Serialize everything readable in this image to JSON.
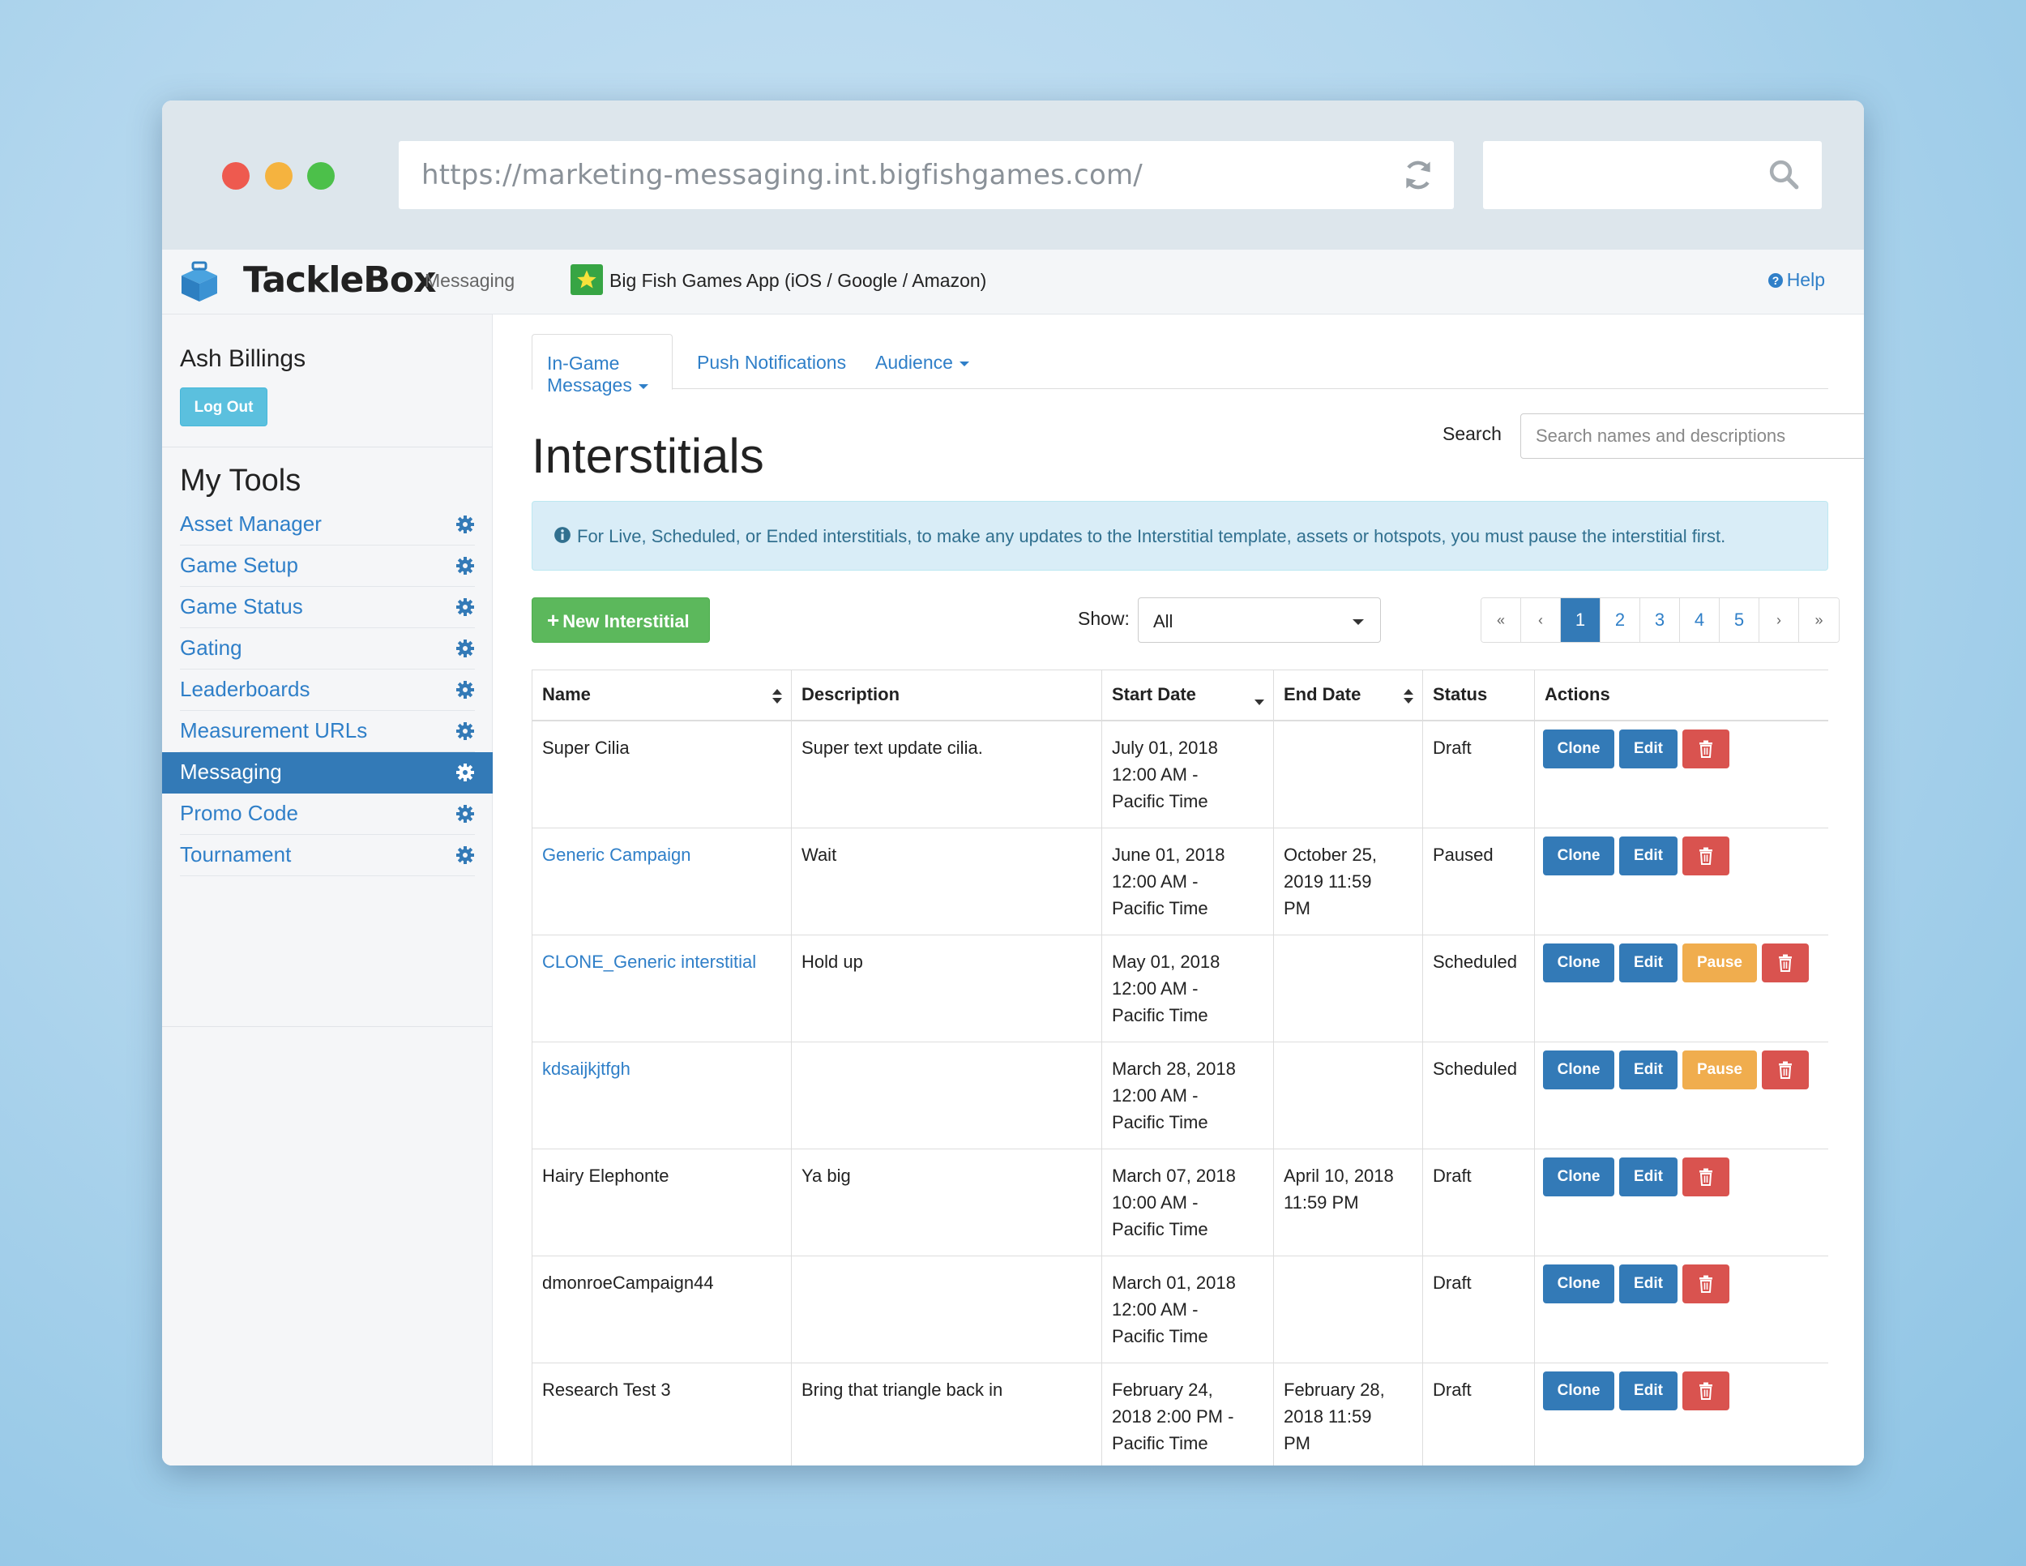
{
  "browser": {
    "url": "https://marketing-messaging.int.bigfishgames.com/",
    "search_value": ""
  },
  "navbar": {
    "logo_text": "TackleBox",
    "section": "Messaging",
    "app_name": "Big Fish Games App (iOS / Google / Amazon)",
    "help": "Help"
  },
  "sidebar": {
    "user_name": "Ash Billings",
    "logout": "Log Out",
    "tools_title": "My Tools",
    "items": [
      {
        "label": "Asset Manager"
      },
      {
        "label": "Game Setup"
      },
      {
        "label": "Game Status"
      },
      {
        "label": "Gating"
      },
      {
        "label": "Leaderboards"
      },
      {
        "label": "Measurement URLs"
      },
      {
        "label": "Messaging",
        "active": true
      },
      {
        "label": "Promo Code"
      },
      {
        "label": "Tournament"
      }
    ]
  },
  "main": {
    "tabs": [
      {
        "label": "In-Game Messages",
        "dropdown": true,
        "active": true
      },
      {
        "label": "Push Notifications"
      },
      {
        "label": "Audience",
        "dropdown": true
      }
    ],
    "title": "Interstitials",
    "search_label": "Search",
    "search_placeholder": "Search names and descriptions",
    "alert": "For Live, Scheduled, or Ended interstitials, to make any updates to the Interstitial template, assets or hotspots, you must pause the interstitial first.",
    "new_button": "New Interstitial",
    "show_label": "Show:",
    "show_value": "All",
    "pagination": {
      "first": "«",
      "prev": "‹",
      "pages": [
        "1",
        "2",
        "3",
        "4",
        "5"
      ],
      "current": "1",
      "next": "›",
      "last": "»"
    }
  },
  "table": {
    "columns": [
      "Name",
      "Description",
      "Start Date",
      "End Date",
      "Status",
      "Actions"
    ],
    "action_labels": {
      "clone": "Clone",
      "edit": "Edit",
      "pause": "Pause"
    },
    "rows": [
      {
        "name": "Super Cilia",
        "link": false,
        "description": "Super text update cilia.",
        "start": "July 01, 2018\n12:00 AM -\nPacific Time",
        "end": "",
        "status": "Draft",
        "pause": false
      },
      {
        "name": "Generic Campaign",
        "link": true,
        "description": "Wait",
        "start": "June 01, 2018\n12:00 AM -\nPacific Time",
        "end": "October 25,\n2019 11:59\nPM",
        "status": "Paused",
        "pause": false
      },
      {
        "name": "CLONE_Generic interstitial",
        "link": true,
        "description": "Hold up",
        "start": "May 01, 2018\n12:00 AM -\nPacific Time",
        "end": "",
        "status": "Scheduled",
        "pause": true
      },
      {
        "name": "kdsaijkjtfgh",
        "link": true,
        "description": "",
        "start": "March 28, 2018\n12:00 AM -\nPacific Time",
        "end": "",
        "status": "Scheduled",
        "pause": true
      },
      {
        "name": "Hairy Elephonte",
        "link": false,
        "description": "Ya big",
        "start": "March 07, 2018\n10:00 AM -\nPacific Time",
        "end": "April 10, 2018\n11:59 PM",
        "status": "Draft",
        "pause": false
      },
      {
        "name": "dmonroeCampaign44",
        "link": false,
        "description": "",
        "start": "March 01, 2018\n12:00 AM -\nPacific Time",
        "end": "",
        "status": "Draft",
        "pause": false
      },
      {
        "name": "Research Test 3",
        "link": false,
        "description": "Bring that triangle back in",
        "start": "February 24,\n2018 2:00 PM -\nPacific Time",
        "end": "February 28,\n2018 11:59\nPM",
        "status": "Draft",
        "pause": false
      }
    ]
  },
  "colors": {
    "primary": "#337ab7",
    "success": "#5cb85c",
    "warning": "#f0ad4e",
    "danger": "#d9534f",
    "info_bg": "#d9edf7",
    "link": "#2f7fc8"
  }
}
